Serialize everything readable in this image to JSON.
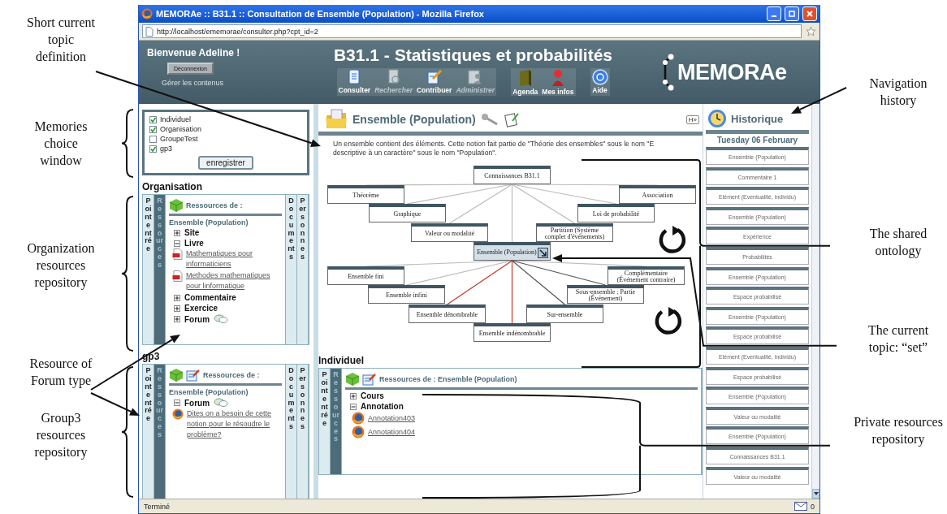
{
  "annotations": {
    "left": [
      "Short current topic definition",
      "Memories choice window",
      "Organization resources repository",
      "Resource of Forum type",
      "Group3 resources repository"
    ],
    "right": [
      "Navigation history",
      "The shared ontology",
      "The current topic: “set”",
      "Private resources repository"
    ]
  },
  "browser": {
    "title": "MEMORAe :: B31.1 :: Consultation de Ensemble (Population) - Mozilla Firefox",
    "url": "http://localhost/ememorae/consulter.php?cpt_id=2",
    "status": "Terminé",
    "mail_count": "0"
  },
  "header": {
    "greeting": "Bienvenue Adeline !",
    "logout": "Déconnexion",
    "manage": "Gérer les contenus",
    "title": "B31.1 - Statistiques et probabilités",
    "logo": "MEMORAe",
    "tool_groups": [
      [
        {
          "label": "Consulter",
          "kind": "consult",
          "disabled": false
        },
        {
          "label": "Rechercher",
          "kind": "search",
          "disabled": true
        },
        {
          "label": "Contribuer",
          "kind": "contribute",
          "disabled": false
        },
        {
          "label": "Administrer",
          "kind": "admin",
          "disabled": true
        }
      ],
      [
        {
          "label": "Agenda",
          "kind": "agenda",
          "disabled": false
        },
        {
          "label": "Mes infos",
          "kind": "profile",
          "disabled": false
        }
      ],
      [
        {
          "label": "Aide",
          "kind": "help",
          "disabled": false
        }
      ]
    ]
  },
  "memories": {
    "items": [
      {
        "label": "Individuel",
        "checked": true
      },
      {
        "label": "Organisation",
        "checked": true
      },
      {
        "label": "GroupeTest",
        "checked": false
      },
      {
        "label": "gp3",
        "checked": true
      }
    ],
    "save": "enregistrer"
  },
  "repositories": [
    {
      "title": "Organisation",
      "editable": false,
      "tabs": [
        {
          "label": "Point entrée",
          "selected": false
        },
        {
          "label": "Ressources",
          "selected": true
        },
        {
          "label": "Documents",
          "selected": false
        },
        {
          "label": "Personnes",
          "selected": false
        }
      ],
      "heading": "Ressources de :",
      "concept": "Ensemble (Population)",
      "tree": [
        {
          "label": "Site",
          "expanded": false
        },
        {
          "label": "Livre",
          "expanded": true,
          "children": [
            {
              "label": "Mathematiques pour informaticiens",
              "kind": "pdf"
            },
            {
              "label": "Methodes mathematiques pour linformatique",
              "kind": "pdf"
            }
          ]
        },
        {
          "label": "Commentaire",
          "expanded": false
        },
        {
          "label": "Exercice",
          "expanded": false
        },
        {
          "label": "Forum",
          "expanded": false,
          "kind": "forum"
        }
      ]
    },
    {
      "title": "gp3",
      "editable": true,
      "tabs": [
        {
          "label": "Point entrée",
          "selected": false
        },
        {
          "label": "Ressources",
          "selected": true
        },
        {
          "label": "Documents",
          "selected": false
        },
        {
          "label": "Personnes",
          "selected": false
        }
      ],
      "heading": "Ressources de :",
      "concept": "Ensemble (Population)",
      "tree": [
        {
          "label": "Forum",
          "expanded": true,
          "kind": "forum",
          "children": [
            {
              "label": "Dites on a besoin de cette notion pour le résoudre le problème?",
              "kind": "web"
            }
          ]
        }
      ]
    },
    {
      "title": "Individuel",
      "editable": true,
      "tabs": [
        {
          "label": "Point entrée",
          "selected": false
        },
        {
          "label": "Ressources",
          "selected": true
        }
      ],
      "heading": "Ressources de : Ensemble (Population)",
      "tree": [
        {
          "label": "Cours",
          "expanded": false
        },
        {
          "label": "Annotation",
          "expanded": true,
          "children": [
            {
              "label": "Annotation403",
              "kind": "web"
            },
            {
              "label": "Annotation404",
              "kind": "web"
            }
          ]
        }
      ]
    }
  ],
  "concept": {
    "title": "Ensemble (Population)",
    "toggle": "H»",
    "definition_lines": [
      "Un ensemble contient des éléments. Cette notion fait partie de \"Théorie des ensembles\" sous le nom \"E",
      "descriptive à un caractère\" sous le nom \"Population\"."
    ],
    "nodes": [
      {
        "label": "Connaissances B31.1",
        "kind": "root"
      },
      {
        "label": "Théorème",
        "kind": "sibling",
        "color": "#bbbbbb"
      },
      {
        "label": "Association",
        "kind": "sibling",
        "color": "#bbbbbb"
      },
      {
        "label": "Graphique",
        "kind": "sibling",
        "color": "#bbbbbb"
      },
      {
        "label": "Loi de probabilité",
        "kind": "sibling",
        "color": "#bbbbbb"
      },
      {
        "label": "Valeur ou modalité",
        "kind": "sibling",
        "color": "#bbbbbb"
      },
      {
        "label": "Partition (Système complet d'événements)",
        "kind": "sibling",
        "color": "#bbbbbb"
      },
      {
        "label": "Ensemble (Population)",
        "kind": "current",
        "color": "#bbbbbb"
      },
      {
        "label": "Ensemble fini",
        "kind": "child",
        "color": "#bbbbbb"
      },
      {
        "label": "Complémentaire (Événement contraire)",
        "kind": "child",
        "color": "#bbbbbb"
      },
      {
        "label": "Ensemble infini",
        "kind": "child",
        "color": "#bbbbbb"
      },
      {
        "label": "Sous-ensemble ; Partie (Événement)",
        "kind": "child",
        "color": "#555555"
      },
      {
        "label": "Ensemble dénombrable",
        "kind": "child",
        "color": "#c0392b"
      },
      {
        "label": "Sur-ensemble",
        "kind": "child",
        "color": "#555555"
      },
      {
        "label": "Ensemble indénombrable",
        "kind": "child",
        "color": "#c0392b"
      }
    ]
  },
  "history": {
    "title": "Historique",
    "date": "Tuesday 06 February",
    "items": [
      "Ensemble (Population)",
      "Commentaire 1",
      "Elément (Eventualité, Individu)",
      "Ensemble (Population)",
      "Expérience",
      "Probabilités",
      "Ensemble (Population)",
      "Espace probabilisé",
      "Ensemble (Population)",
      "Espace probabilisé",
      "Elément (Eventualité, Individu)",
      "Espace probabilisé",
      "Ensemble (Population)",
      "Valeur ou modalité",
      "Ensemble (Population)",
      "Connaissances B31.1",
      "Valeur ou modalité"
    ]
  }
}
